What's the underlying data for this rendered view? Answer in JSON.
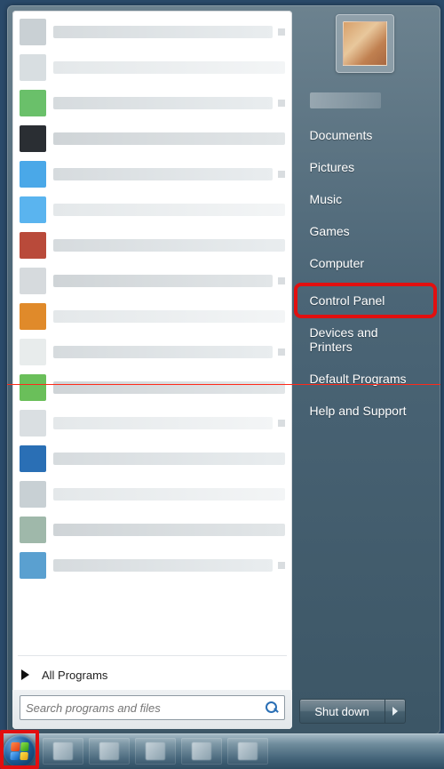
{
  "left": {
    "all_programs_label": "All Programs",
    "search_placeholder": "Search programs and files"
  },
  "right": {
    "items": [
      {
        "label": "Documents"
      },
      {
        "label": "Pictures"
      },
      {
        "label": "Music"
      },
      {
        "label": "Games"
      },
      {
        "label": "Computer"
      },
      {
        "label": "Control Panel",
        "highlighted": true
      },
      {
        "label": "Devices and Printers"
      },
      {
        "label": "Default Programs"
      },
      {
        "label": "Help and Support"
      }
    ],
    "shutdown_label": "Shut down"
  },
  "annotations": {
    "control_panel_box": true,
    "start_orb_box": true,
    "horizontal_red_line": true
  },
  "colors": {
    "highlight": "#e20f0f"
  }
}
